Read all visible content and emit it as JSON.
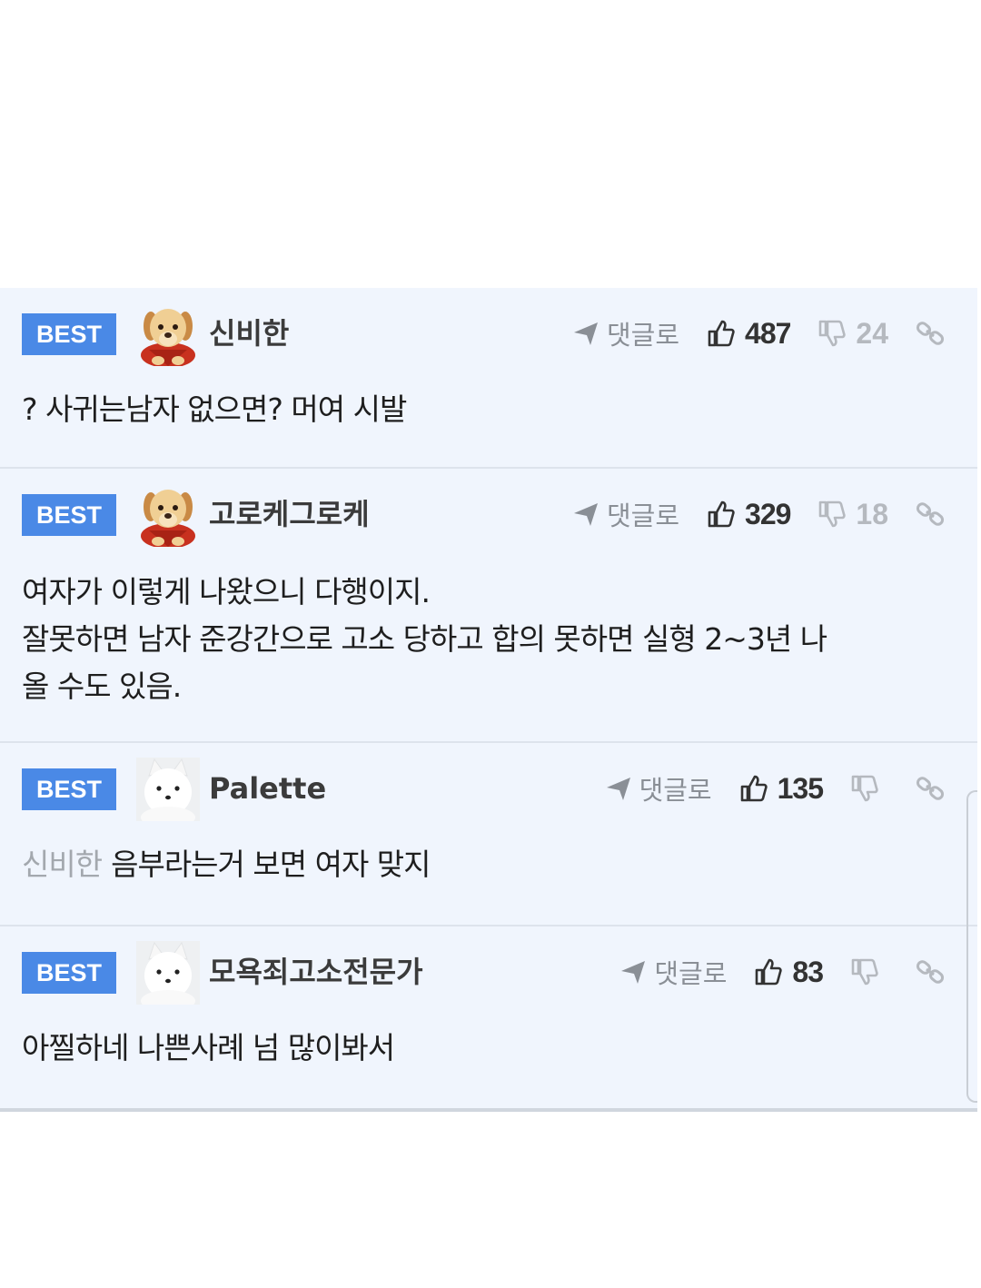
{
  "comments": [
    {
      "badge": "BEST",
      "avatar": "puppy-avatar",
      "nickname": "신비한",
      "reply_label": "댓글로",
      "likes": "487",
      "dislikes": "24",
      "mention": "",
      "lines": [
        "? 사귀는남자 없으면? 머여 시발"
      ]
    },
    {
      "badge": "BEST",
      "avatar": "puppy-avatar",
      "nickname": "고로케그로케",
      "reply_label": "댓글로",
      "likes": "329",
      "dislikes": "18",
      "mention": "",
      "lines": [
        "여자가 이렇게 나왔으니 다행이지.",
        "잘못하면 남자 준강간으로 고소 당하고 합의 못하면 실형 2~3년 나",
        "올 수도 있음."
      ]
    },
    {
      "badge": "BEST",
      "avatar": "white-dog-avatar",
      "nickname": "Palette",
      "reply_label": "댓글로",
      "likes": "135",
      "dislikes": "",
      "mention": "신비한",
      "lines": [
        "음부라는거 보면 여자 맞지"
      ]
    },
    {
      "badge": "BEST",
      "avatar": "white-dog-avatar",
      "nickname": "모욕죄고소전문가",
      "reply_label": "댓글로",
      "likes": "83",
      "dislikes": "",
      "mention": "",
      "lines": [
        "아찔하네 나쁜사례 넘 많이봐서"
      ]
    }
  ],
  "colors": {
    "badge_bg": "#4a89e6",
    "panel_bg": "#f0f5fd",
    "mention": "#a3a8ae",
    "muted": "#8a8f96"
  }
}
